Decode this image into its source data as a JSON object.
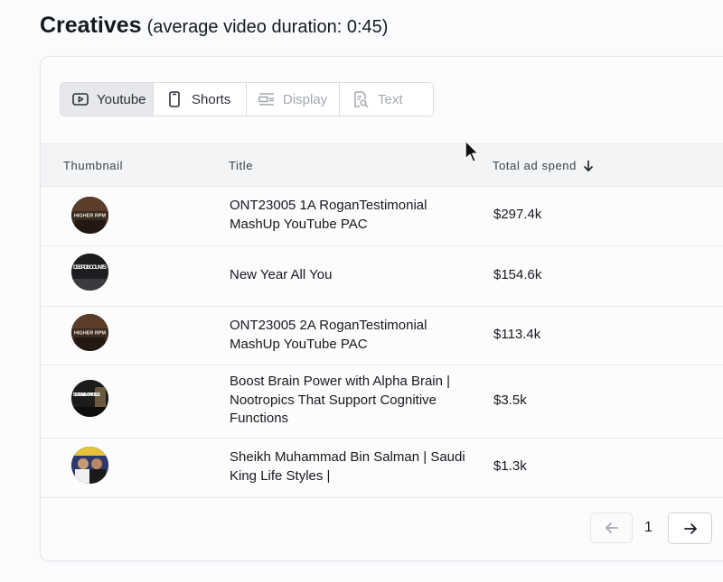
{
  "header": {
    "title": "Creatives",
    "subtitle": "(average video duration: 0:45)"
  },
  "tabs": [
    {
      "label": "Youtube",
      "icon": "play-icon",
      "state": "active"
    },
    {
      "label": "Shorts",
      "icon": "phone-icon",
      "state": "normal"
    },
    {
      "label": "Display",
      "icon": "display-icon",
      "state": "disabled"
    },
    {
      "label": "Text",
      "icon": "text-search-icon",
      "state": "disabled"
    }
  ],
  "table": {
    "columns": [
      "Thumbnail",
      "Title",
      "Total ad spend"
    ],
    "sort_icon": "arrow-down-icon",
    "rows": [
      {
        "thumb_text": "HIGHER RPM",
        "title": "ONT23005 1A RoganTestimonial MashUp YouTube PAC",
        "spend": "$297.4k"
      },
      {
        "thumb_text": "DEEP DISCOUNTS",
        "title": "New Year All You",
        "spend": "$154.6k"
      },
      {
        "thumb_text": "HIGHER RPM",
        "title": "ONT23005 2A RoganTestimonial MashUp YouTube PAC",
        "spend": "$113.4k"
      },
      {
        "thumb_text": "BETTER MEMORY FOCUS",
        "title": "Boost Brain Power with Alpha Brain | Nootropics That Support Cognitive Functions",
        "spend": "$3.5k"
      },
      {
        "thumb_text": "",
        "title": "Sheikh Muhammad Bin Salman | Saudi King Life Styles |",
        "spend": "$1.3k"
      }
    ]
  },
  "pagination": {
    "page": "1",
    "prev_icon": "arrow-left-icon",
    "next_icon": "arrow-right-icon"
  },
  "colors": {
    "active_tab": "#e6e8ec",
    "disabled_text": "#a3a8b1"
  }
}
